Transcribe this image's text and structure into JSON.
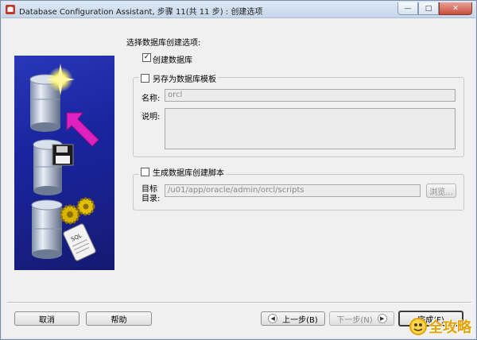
{
  "window": {
    "title": "Database Configuration Assistant, 步骤 11(共 11 步) : 创建选项",
    "controls": {
      "minimize": "—",
      "maximize": "□",
      "close": "✕"
    }
  },
  "main": {
    "prompt": "选择数据库创建选项:",
    "create_db": {
      "label": "创建数据库",
      "checked": true
    },
    "save_template": {
      "label": "另存为数据库模板",
      "checked": false,
      "name_label": "名称:",
      "name_value": "orcl",
      "desc_label": "说明:",
      "desc_value": ""
    },
    "gen_scripts": {
      "label": "生成数据库创建脚本",
      "checked": false,
      "dest_label_1": "目标",
      "dest_label_2": "目录:",
      "dest_value": "/u01/app/oracle/admin/orcl/scripts",
      "browse_label": "浏览..."
    }
  },
  "footer": {
    "cancel": "取消",
    "help": "帮助",
    "back": "上一步(B)",
    "next": "下一步(N)",
    "finish": "完成(F)"
  },
  "watermark": {
    "text": "全攻略"
  },
  "colors": {
    "art_blue": "#1a24a0",
    "arrow_magenta": "#e020c0",
    "watermark": "#e6a100"
  }
}
